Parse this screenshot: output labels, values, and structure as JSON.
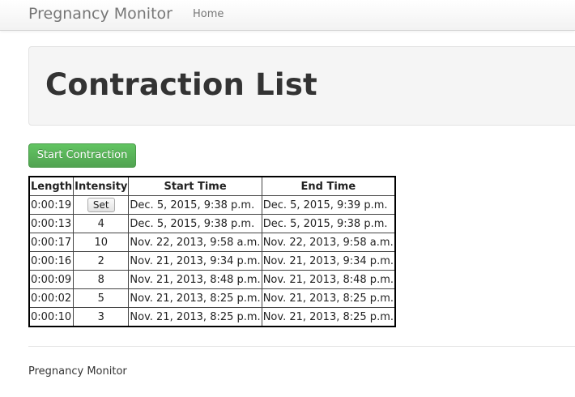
{
  "navbar": {
    "brand": "Pregnancy Monitor",
    "home_label": "Home"
  },
  "hero": {
    "title": "Contraction List"
  },
  "actions": {
    "start_label": "Start Contraction"
  },
  "table": {
    "headers": {
      "length": "Length",
      "intensity": "Intensity",
      "start": "Start Time",
      "end": "End Time"
    },
    "set_label": "Set",
    "rows": [
      {
        "length": "0:00:19",
        "intensity": "",
        "start": "Dec. 5, 2015, 9:38 p.m.",
        "end": "Dec. 5, 2015, 9:39 p.m."
      },
      {
        "length": "0:00:13",
        "intensity": "4",
        "start": "Dec. 5, 2015, 9:38 p.m.",
        "end": "Dec. 5, 2015, 9:38 p.m."
      },
      {
        "length": "0:00:17",
        "intensity": "10",
        "start": "Nov. 22, 2013, 9:58 a.m.",
        "end": "Nov. 22, 2013, 9:58 a.m."
      },
      {
        "length": "0:00:16",
        "intensity": "2",
        "start": "Nov. 21, 2013, 9:34 p.m.",
        "end": "Nov. 21, 2013, 9:34 p.m."
      },
      {
        "length": "0:00:09",
        "intensity": "8",
        "start": "Nov. 21, 2013, 8:48 p.m.",
        "end": "Nov. 21, 2013, 8:48 p.m."
      },
      {
        "length": "0:00:02",
        "intensity": "5",
        "start": "Nov. 21, 2013, 8:25 p.m.",
        "end": "Nov. 21, 2013, 8:25 p.m."
      },
      {
        "length": "0:00:10",
        "intensity": "3",
        "start": "Nov. 21, 2013, 8:25 p.m.",
        "end": "Nov. 21, 2013, 8:25 p.m."
      }
    ]
  },
  "footer": {
    "text": "Pregnancy Monitor"
  },
  "colors": {
    "success": "#5bb75b",
    "navbar_text": "#777777",
    "hero_bg": "#f5f5f5"
  }
}
